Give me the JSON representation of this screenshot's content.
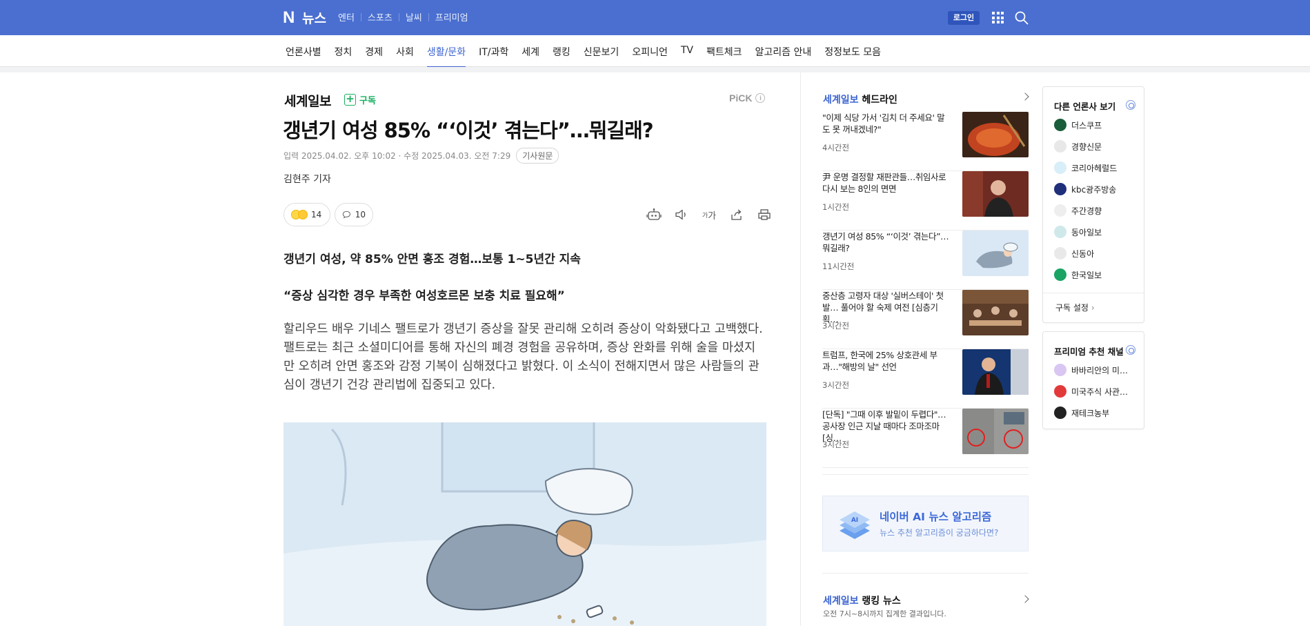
{
  "topbar": {
    "logo_letter": "N",
    "logo_text": "뉴스",
    "menu": [
      "엔터",
      "스포츠",
      "날씨",
      "프리미엄"
    ],
    "login_label": "로그인"
  },
  "sections": [
    "언론사별",
    "정치",
    "경제",
    "사회",
    "생활/문화",
    "IT/과학",
    "세계",
    "랭킹",
    "신문보기",
    "오피니언",
    "TV",
    "팩트체크",
    "알고리즘 안내",
    "정정보도 모음"
  ],
  "active_section": "생활/문화",
  "article": {
    "press": "세계일보",
    "subscribe_label": "구독",
    "pick_label": "PiCK",
    "pick_info": "i",
    "title": "갱년기 여성 85% “‘이것’ 겪는다”…뭐길래?",
    "dateline": "입력 2025.04.02. 오후 10:02 · 수정 2025.04.03. 오전 7:29",
    "original_label": "기사원문",
    "reporter": "김현주 기자",
    "reaction_count": "14",
    "comment_count": "10",
    "font_size_label": "가",
    "font_size_prefix": "가",
    "lead1": "갱년기 여성, 약 85% 안면 홍조 경험…보통 1~5년간 지속",
    "lead2": "“증상 심각한 경우 부족한 여성호르몬 보충 치료 필요해”",
    "body": "할리우드 배우 기네스 팰트로가 갱년기 증상을 잘못 관리해 오히려 증상이 악화됐다고 고백했다. 팰트로는 최근 소셜미디어를 통해 자신의 폐경 경험을 공유하며, 증상 완화를 위해 술을 마셨지만 오히려 안면 홍조와 감정 기복이 심해졌다고 밝혔다. 이 소식이 전해지면서 많은 사람들의 관심이 갱년기 건강 관리법에 집중되고 있다."
  },
  "headlines": {
    "press": "세계일보",
    "title_suffix": "헤드라인",
    "items": [
      {
        "text": "\"이제 식당 가서 '김치 더 주세요' 말도 못 꺼내겠네?\"",
        "time": "4시간전"
      },
      {
        "text": "尹 운명 결정할 재판관들…취임사로 다시 보는 8인의 면면",
        "time": "1시간전"
      },
      {
        "text": "갱년기 여성 85% “‘이것’ 겪는다”…뭐길래?",
        "time": "11시간전"
      },
      {
        "text": "중산층 고령자 대상 '실버스테이' 첫발… 풀어야 할 숙제 여전 [심층기획…",
        "time": "3시간전"
      },
      {
        "text": "트럼프, 한국에 25% 상호관세 부과…\"해방의 날\" 선언",
        "time": "3시간전"
      },
      {
        "text": "[단독] \"그때 이후 발밑이 두렵다\"…공사장 인근 지날 때마다 조마조마 [싱…",
        "time": "3시간전"
      }
    ]
  },
  "ai_banner": {
    "badge": "AI",
    "title": "네이버 AI 뉴스 알고리즘",
    "subtitle": "뉴스 추천 알고리즘이 궁금하다면?"
  },
  "ranking": {
    "press": "세계일보",
    "title_suffix": "랭킹 뉴스",
    "subtitle": "오전 7시~8시까지 집계한 결과입니다."
  },
  "other_press": {
    "title": "다른 언론사 보기",
    "items": [
      {
        "name": "더스쿠프",
        "color": "#1a5d3a"
      },
      {
        "name": "경향신문",
        "color": "#e8e8e8"
      },
      {
        "name": "코리아헤럴드",
        "color": "#d8eef8"
      },
      {
        "name": "kbc광주방송",
        "color": "#1f2f7a"
      },
      {
        "name": "주간경향",
        "color": "#eeeeee"
      },
      {
        "name": "동아일보",
        "color": "#cfe9ea"
      },
      {
        "name": "신동아",
        "color": "#e9e9e9"
      },
      {
        "name": "한국일보",
        "color": "#19a463"
      }
    ],
    "setting_label": "구독 설정"
  },
  "premium": {
    "title": "프리미엄 추천 채널",
    "items": [
      {
        "name": "바바리안의 미…",
        "color": "#d9c6f2"
      },
      {
        "name": "미국주식 사관…",
        "color": "#e23a3a"
      },
      {
        "name": "재테크농부",
        "color": "#222222"
      }
    ]
  },
  "colors": {
    "brand_blue": "#4a6fd0",
    "accent_blue": "#3c64d0",
    "subscribe_green": "#18b060"
  }
}
